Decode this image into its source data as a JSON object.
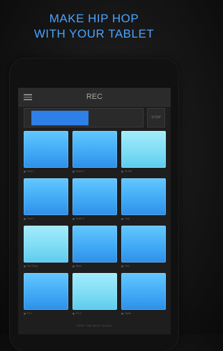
{
  "headline": {
    "line1": "MAKE HIP HOP",
    "line2": "WITH YOUR TABLET"
  },
  "app": {
    "title": "REC",
    "rec_button_label": "STOP",
    "record_progress": 0.48,
    "footer": "KEEP THE BEAT GOING"
  },
  "pads": [
    {
      "label": "Kick 1",
      "style": "blue"
    },
    {
      "label": "Snare 1",
      "style": "blue"
    },
    {
      "label": "Hi-Hat",
      "style": "light"
    },
    {
      "label": "Kick 2",
      "style": "blue"
    },
    {
      "label": "Snare 2",
      "style": "blue"
    },
    {
      "label": "Clap",
      "style": "blue"
    },
    {
      "label": "Vox Chop",
      "style": "light"
    },
    {
      "label": "Bass",
      "style": "blue"
    },
    {
      "label": "Perc",
      "style": "blue"
    },
    {
      "label": "FX 1",
      "style": "blue"
    },
    {
      "label": "FX 2",
      "style": "light"
    },
    {
      "label": "Synth",
      "style": "blue"
    }
  ],
  "colors": {
    "accent": "#4aa3ff",
    "pad_blue": "#3fa8f5",
    "pad_light": "#7fddf5",
    "rec_fill": "#2f7fe8"
  }
}
